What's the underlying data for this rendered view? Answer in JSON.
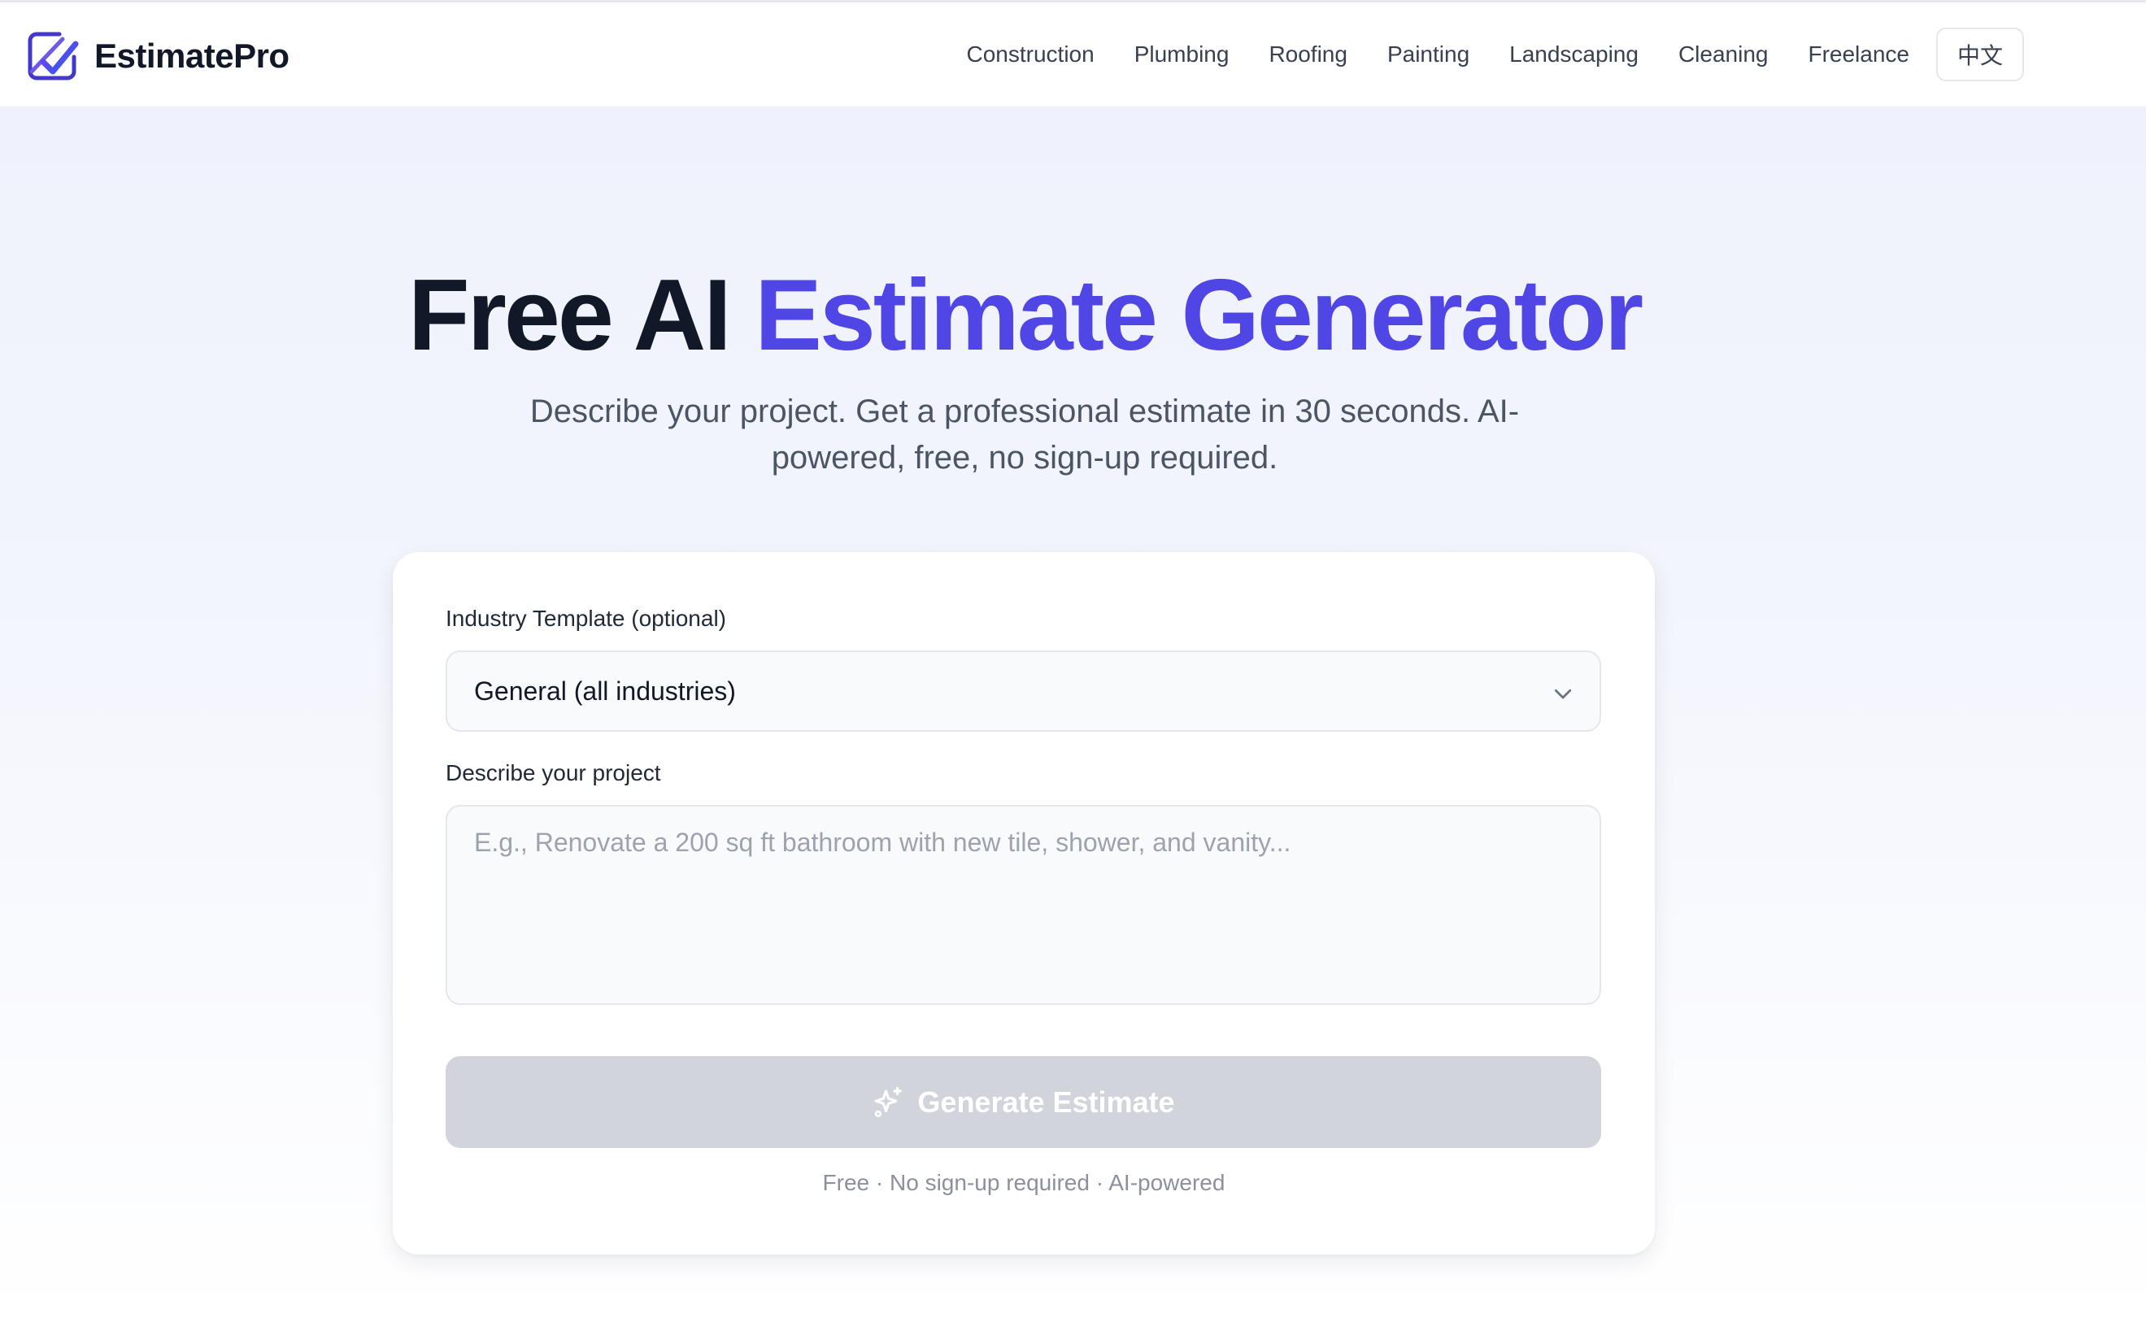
{
  "brand": {
    "name": "EstimatePro"
  },
  "nav": {
    "links": [
      "Construction",
      "Plumbing",
      "Roofing",
      "Painting",
      "Landscaping",
      "Cleaning",
      "Freelance"
    ],
    "language_button": "中文"
  },
  "hero": {
    "title_part1": "Free AI ",
    "title_accent": "Estimate Generator",
    "subtitle": "Describe your project. Get a professional estimate in 30 seconds. AI-powered, free, no sign-up required."
  },
  "form": {
    "industry_label": "Industry Template (optional)",
    "industry_selected": "General (all industries)",
    "project_label": "Describe your project",
    "project_value": "",
    "project_placeholder": "E.g., Renovate a 200 sq ft bathroom with new tile, shower, and vanity...",
    "generate_label": "Generate Estimate",
    "footnote": "Free · No sign-up required · AI-powered"
  },
  "icons": {
    "logo": "logo-checkmark-icon",
    "select": "chevron-down-icon",
    "generate": "sparkles-icon"
  },
  "colors": {
    "accent": "#4f46e5",
    "title": "#111827",
    "button_disabled": "#d1d5db"
  }
}
